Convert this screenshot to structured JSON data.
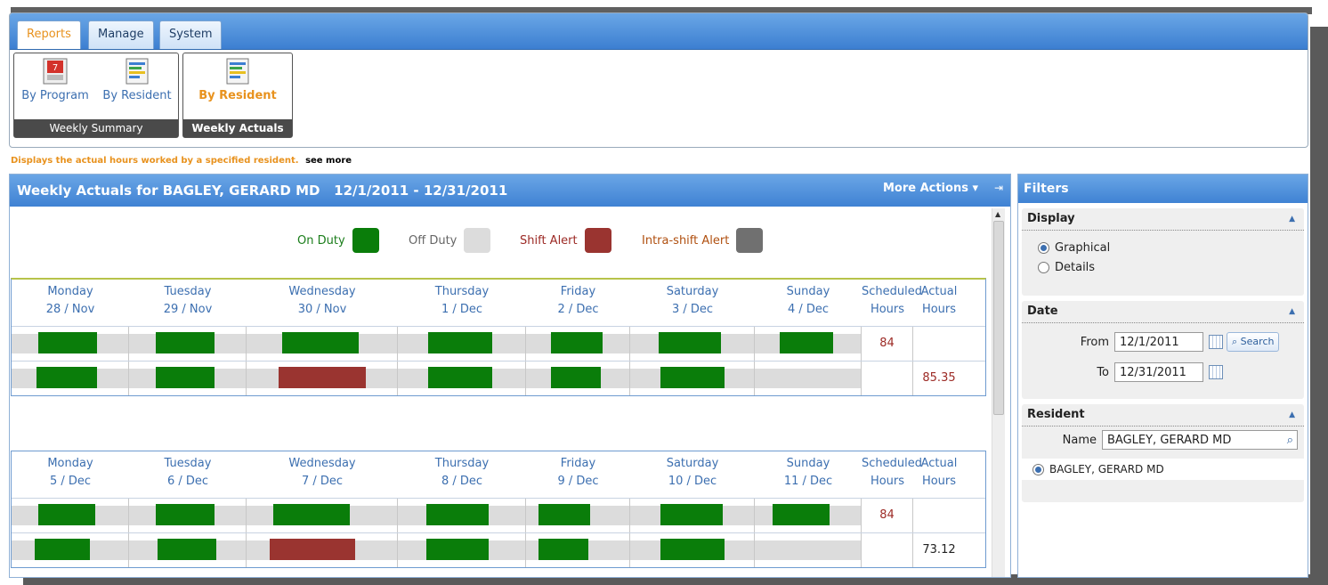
{
  "ribbon": {
    "tabs": [
      {
        "label": "Reports",
        "active": true
      },
      {
        "label": "Manage",
        "active": false
      },
      {
        "label": "System",
        "active": false
      }
    ],
    "groups": [
      {
        "label": "Weekly Summary",
        "buttons": [
          {
            "label": "By Program",
            "icon": "calendar-icon"
          },
          {
            "label": "By Resident",
            "icon": "schedule-icon"
          }
        ]
      },
      {
        "label": "Weekly Actuals",
        "buttons": [
          {
            "label": "By Resident",
            "icon": "schedule-icon",
            "selected": true
          }
        ]
      }
    ]
  },
  "hint": {
    "text": "Displays the actual hours worked by a specified resident.",
    "link": "see more"
  },
  "panel": {
    "title": "Weekly Actuals for BAGLEY, GERARD MD   12/1/2011 - 12/31/2011",
    "more_actions": "More Actions ▾",
    "pin": "⇥"
  },
  "legend": [
    {
      "label": "On Duty",
      "color": "#0a7d0a",
      "text_color": "#1a7d1a"
    },
    {
      "label": "Off Duty",
      "color": "#dcdcdc",
      "text_color": "#666666"
    },
    {
      "label": "Shift Alert",
      "color": "#9a3430",
      "text_color": "#9c2a25"
    },
    {
      "label": "Intra-shift Alert",
      "color": "#707070",
      "text_color": "#b05010"
    }
  ],
  "colors": {
    "on_duty": "#0a7d0a",
    "shift_alert": "#9a3430",
    "off_duty": "#dcdcdc",
    "accent": "#e8921e",
    "header_blue": "#3f82d3"
  },
  "weeks": [
    {
      "days": [
        {
          "name": "Monday",
          "date": "28 / Nov"
        },
        {
          "name": "Tuesday",
          "date": "29 / Nov"
        },
        {
          "name": "Wednesday",
          "date": "30 / Nov"
        },
        {
          "name": "Thursday",
          "date": "1 / Dec"
        },
        {
          "name": "Friday",
          "date": "2 / Dec"
        },
        {
          "name": "Saturday",
          "date": "3 / Dec"
        },
        {
          "name": "Sunday",
          "date": "4 / Dec"
        }
      ],
      "scheduled_label": "Scheduled\nHours",
      "actual_label": "Actual\nHours",
      "scheduled_hours": "84",
      "actual_hours": "85.35"
    },
    {
      "days": [
        {
          "name": "Monday",
          "date": "5 / Dec"
        },
        {
          "name": "Tuesday",
          "date": "6 / Dec"
        },
        {
          "name": "Wednesday",
          "date": "7 / Dec"
        },
        {
          "name": "Thursday",
          "date": "8 / Dec"
        },
        {
          "name": "Friday",
          "date": "9 / Dec"
        },
        {
          "name": "Saturday",
          "date": "10 / Dec"
        },
        {
          "name": "Sunday",
          "date": "11 / Dec"
        }
      ],
      "scheduled_label": "Scheduled\nHours",
      "actual_label": "Actual\nHours",
      "scheduled_hours": "84",
      "actual_hours": "73.12"
    }
  ],
  "filters": {
    "title": "Filters",
    "display": {
      "title": "Display",
      "options": [
        {
          "label": "Graphical",
          "checked": true
        },
        {
          "label": "Details",
          "checked": false
        }
      ]
    },
    "date": {
      "title": "Date",
      "from_label": "From",
      "from_value": "12/1/2011",
      "to_label": "To",
      "to_value": "12/31/2011",
      "search_label": "Search"
    },
    "resident": {
      "title": "Resident",
      "name_label": "Name",
      "name_value": "BAGLEY, GERARD MD",
      "result": "BAGLEY, GERARD MD"
    }
  }
}
